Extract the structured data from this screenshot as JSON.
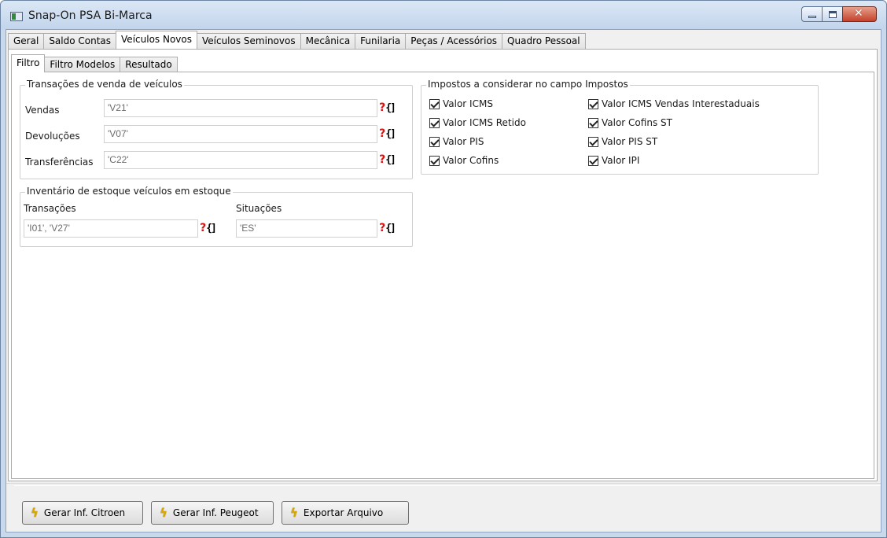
{
  "window": {
    "title": "Snap-On PSA Bi-Marca",
    "close_glyph": "✕"
  },
  "main_tabs": [
    {
      "label": "Geral"
    },
    {
      "label": "Saldo Contas"
    },
    {
      "label": "Veículos Novos"
    },
    {
      "label": "Veículos Seminovos"
    },
    {
      "label": "Mecânica"
    },
    {
      "label": "Funilaria"
    },
    {
      "label": "Peças / Acessórios"
    },
    {
      "label": "Quadro Pessoal"
    }
  ],
  "active_main_tab": "Veículos Novos",
  "sub_tabs": [
    {
      "label": "Filtro"
    },
    {
      "label": "Filtro Modelos"
    },
    {
      "label": "Resultado"
    }
  ],
  "active_sub_tab": "Filtro",
  "transacoes": {
    "title": "Transações de venda de veículos",
    "vendas_label": "Vendas",
    "vendas_value": "'V21'",
    "devolucoes_label": "Devoluções",
    "devolucoes_value": "'V07'",
    "transferencias_label": "Transferências",
    "transferencias_value": "'C22'"
  },
  "inventario": {
    "title": "Inventário de estoque veículos em estoque",
    "transacoes_label": "Transações",
    "transacoes_value": "'I01', 'V27'",
    "situacoes_label": "Situações",
    "situacoes_value": "'ES'"
  },
  "impostos": {
    "title": "Impostos a considerar no campo Impostos",
    "options": [
      {
        "label": "Valor ICMS",
        "checked": true
      },
      {
        "label": "Valor ICMS Retido",
        "checked": true
      },
      {
        "label": "Valor PIS",
        "checked": true
      },
      {
        "label": "Valor Cofins",
        "checked": true
      },
      {
        "label": "Valor ICMS Vendas Interestaduais",
        "checked": true
      },
      {
        "label": "Valor Cofins ST",
        "checked": true
      },
      {
        "label": "Valor PIS ST",
        "checked": true
      },
      {
        "label": "Valor IPI",
        "checked": true
      }
    ]
  },
  "lookup_button": {
    "q": "?",
    "b": "{]"
  },
  "footer": {
    "gerar_citroen": "Gerar Inf. Citroen",
    "gerar_peugeot": "Gerar Inf. Peugeot",
    "exportar": "Exportar Arquivo",
    "bolt_glyph": "ϟ"
  },
  "colors": {
    "title_bar": "#c9d9ec",
    "close_button": "#c4412b",
    "lookup_q": "#e01010",
    "bolt": "#d9a900"
  }
}
